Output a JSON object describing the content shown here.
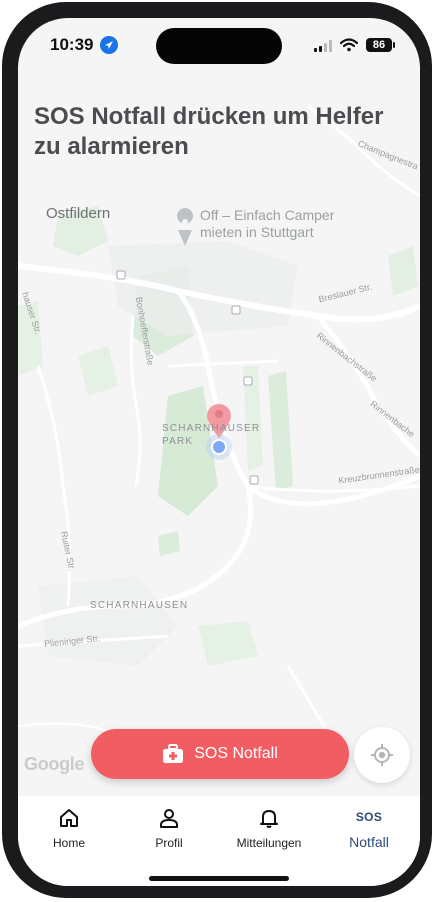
{
  "status_bar": {
    "time": "10:39",
    "battery": "86",
    "icons": [
      "location-arrow-icon",
      "signal-icon",
      "wifi-icon",
      "battery-icon"
    ]
  },
  "header": {
    "title": "SOS Notfall drücken um Helfer zu alarmieren"
  },
  "map": {
    "labels": {
      "city": "Ostfildern",
      "poi": "Off – Einfach Camper mieten in Stuttgart",
      "champagne": "Champagnestra",
      "breslauer": "Breslauer Str.",
      "bonhoeffer": "Bonhoefferstraße",
      "rinnenbach": "Rinnenbachstraße",
      "rinnenbach2": "Rinnenbache",
      "park": "SCHARNHAUSER PARK",
      "kreuzbrunnen": "Kreuzbrunnenstraße",
      "ruiter": "Ruiter Str.",
      "scharnhausen": "SCHARNHAUSEN",
      "plieninger": "Plieninger Str.",
      "hauser": "hauser Str."
    },
    "attribution": "Google"
  },
  "sos_button": {
    "label": "SOS Notfall",
    "icon": "first-aid-kit-icon"
  },
  "locate_button": {
    "icon": "crosshair-location-icon"
  },
  "tabs": [
    {
      "label": "Home",
      "icon": "home-icon",
      "active": false
    },
    {
      "label": "Profil",
      "icon": "person-icon",
      "active": false
    },
    {
      "label": "Mitteilungen",
      "icon": "bell-icon",
      "active": false
    },
    {
      "label": "Notfall",
      "icon_text": "SOS",
      "active": true
    }
  ],
  "colors": {
    "accent_red": "#f25c63",
    "active_tab": "#2c4d7a",
    "marker": "#f19a9f",
    "user_location": "#7ea8f0"
  }
}
